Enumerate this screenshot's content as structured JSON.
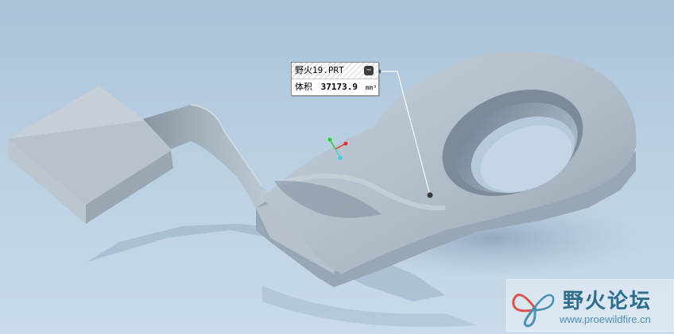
{
  "part_callout": {
    "part_name": "野火19.PRT",
    "volume_label": "体积",
    "volume_value": "37173.9",
    "volume_unit": "mm³",
    "collapse_symbol": "−"
  },
  "watermark": {
    "title": "野火论坛",
    "url": "www.proewildfire.cn"
  },
  "colors": {
    "background_top": "#aac3da",
    "background_bottom": "#c9dbea",
    "part_surface": "#a3b0bd",
    "axis_x": "#e8312a",
    "axis_y": "#2ecc40",
    "axis_z": "#3fd0e0"
  },
  "icons": [
    "collapse-icon",
    "coordinate-triad-icon",
    "butterfly-logo-icon"
  ]
}
